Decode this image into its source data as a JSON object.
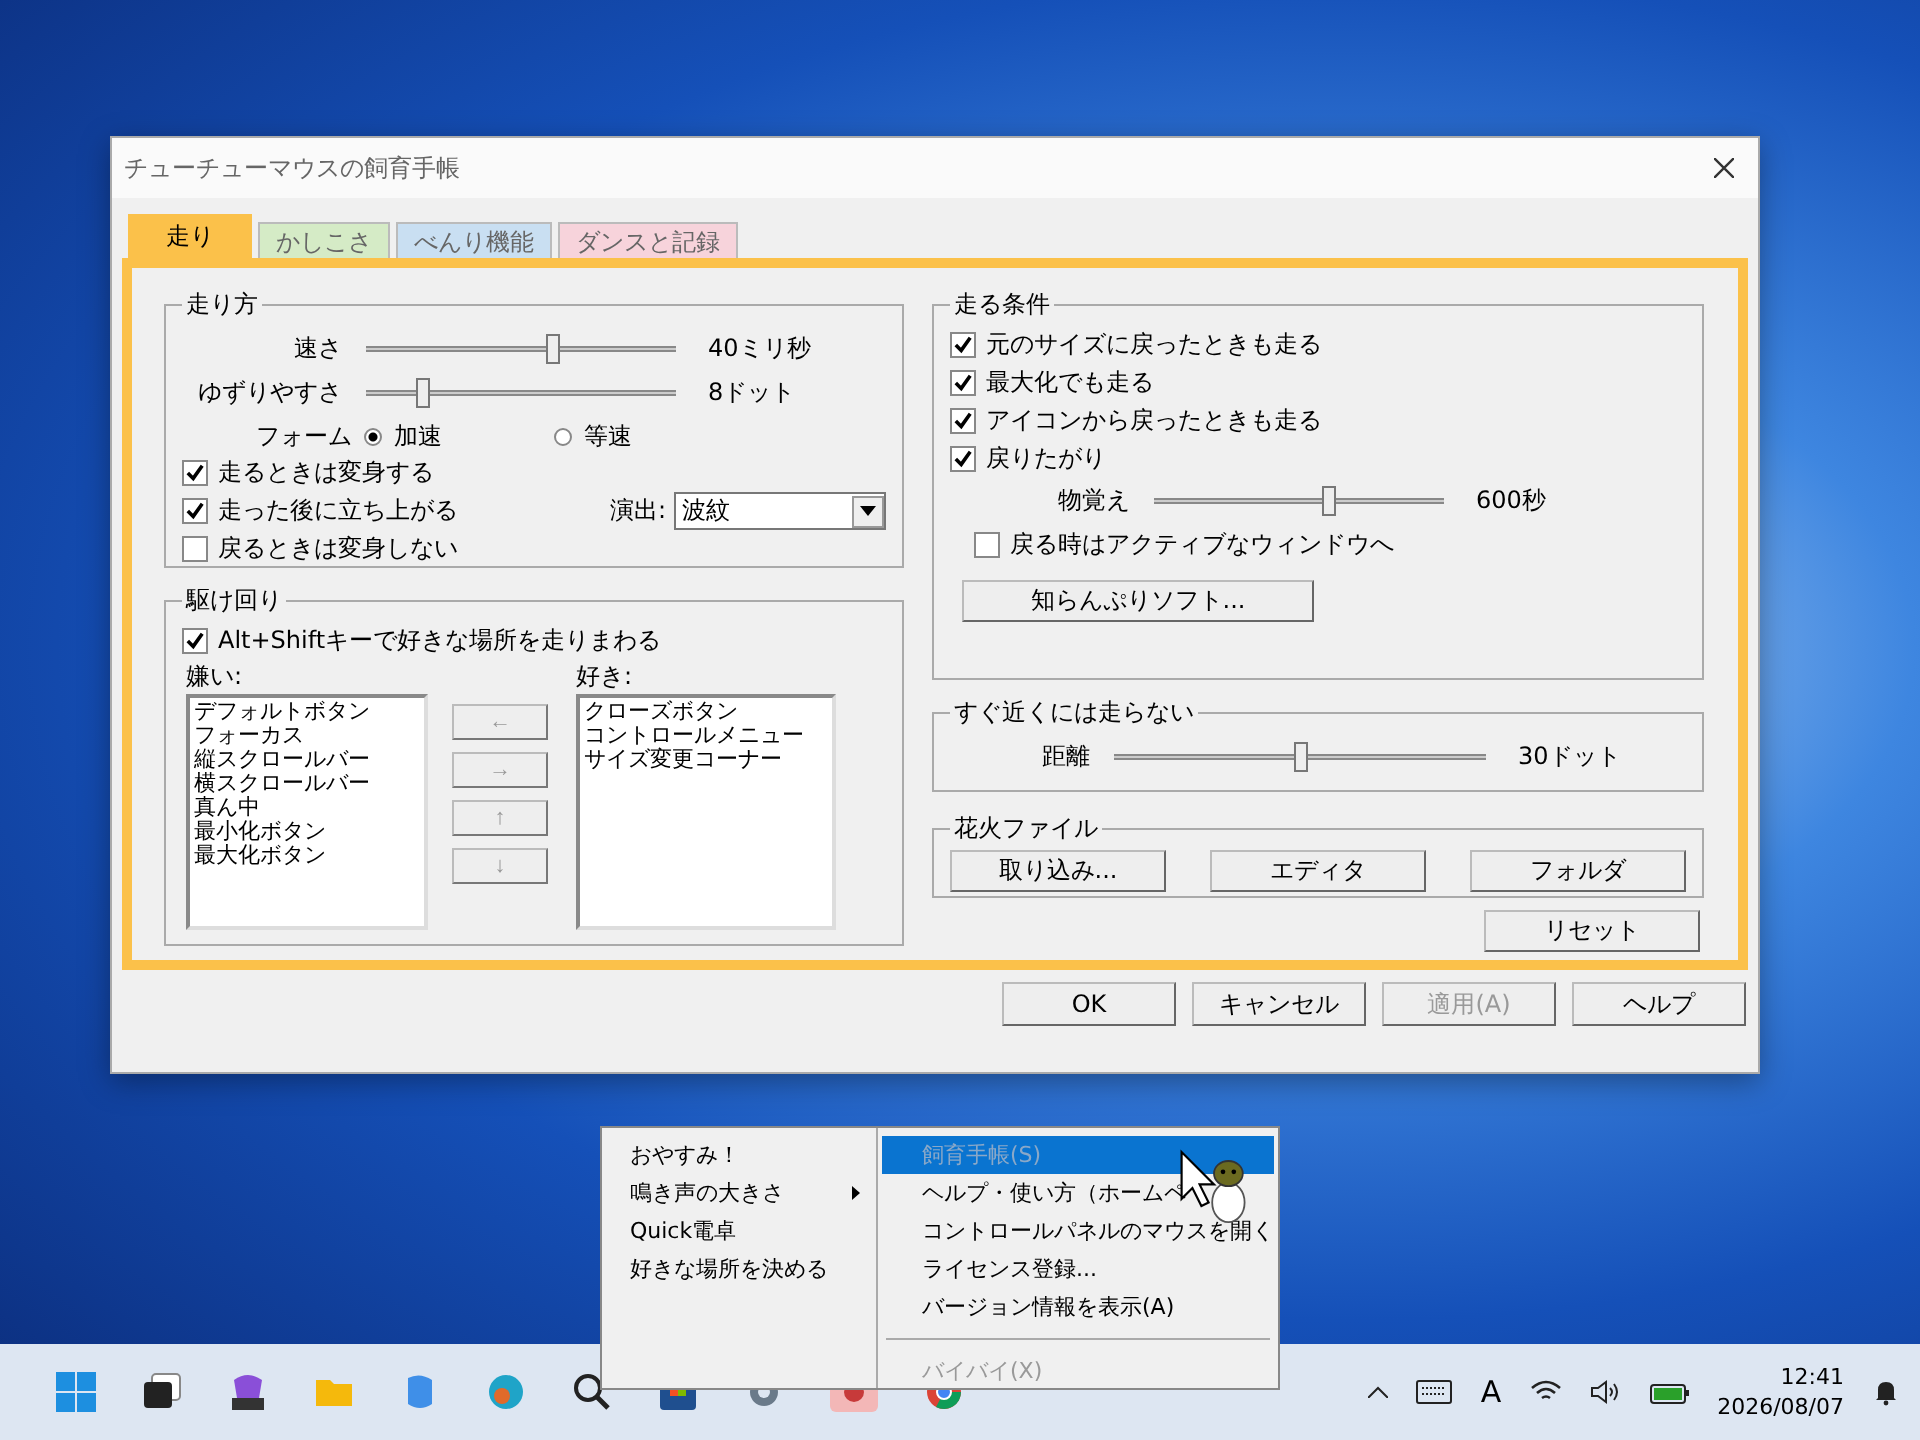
{
  "window": {
    "title": "チューチューマウスの飼育手帳"
  },
  "tabs": [
    {
      "label": "走り",
      "selected": true,
      "color": "#fbc14a"
    },
    {
      "label": "かしこさ",
      "selected": false,
      "color": "#d5ebc6"
    },
    {
      "label": "べんり機能",
      "selected": false,
      "color": "#c9dff2"
    },
    {
      "label": "ダンスと記録",
      "selected": false,
      "color": "#f7d3db"
    }
  ],
  "run_style": {
    "title": "走り方",
    "sliders": [
      {
        "label": "速さ",
        "level": 0.6,
        "reading": "40ミリ秒"
      },
      {
        "label": "ゆずりやすさ",
        "level": 0.18,
        "reading": "8ドット"
      }
    ],
    "form": {
      "label": "フォーム",
      "options": [
        {
          "label": "加速",
          "selected": true
        },
        {
          "label": "等速",
          "selected": false
        }
      ]
    },
    "checks": [
      {
        "label": "走るときは変身する",
        "checked": true
      },
      {
        "label": "走った後に立ち上がる",
        "checked": true
      },
      {
        "label": "戻るときは変身しない",
        "checked": false
      }
    ],
    "effect": {
      "label": "演出:",
      "value": "波紋"
    }
  },
  "roam": {
    "title": "駆け回り",
    "check": {
      "label": "Alt+Shiftキーで好きな場所を走りまわる",
      "checked": true
    },
    "dislike": {
      "label": "嫌い:",
      "items": [
        "デフォルトボタン",
        "フォーカス",
        "縦スクロールバー",
        "横スクロールバー",
        "真ん中",
        "最小化ボタン",
        "最大化ボタン"
      ]
    },
    "like": {
      "label": "好き:",
      "items": [
        "クローズボタン",
        "コントロールメニュー",
        "サイズ変更コーナー"
      ]
    },
    "arrows": [
      "←",
      "→",
      "↑",
      "↓"
    ]
  },
  "conditions": {
    "title": "走る条件",
    "checks": [
      {
        "label": "元のサイズに戻ったときも走る",
        "checked": true
      },
      {
        "label": "最大化でも走る",
        "checked": true
      },
      {
        "label": "アイコンから戻ったときも走る",
        "checked": true
      },
      {
        "label": "戻りたがり",
        "checked": true
      }
    ],
    "slider": {
      "label": "物覚え",
      "level": 0.6,
      "reading": "600秒"
    },
    "check": {
      "label": "戻る時はアクティブなウィンドウへ",
      "checked": false
    },
    "button": "知らんぷりソフト..."
  },
  "near": {
    "title": "すぐ近くには走らない",
    "slider": {
      "label": "距離",
      "level": 0.5,
      "reading": "30ドット"
    }
  },
  "fireworks": {
    "title": "花火ファイル",
    "buttons": [
      "取り込み...",
      "エディタ",
      "フォルダ"
    ]
  },
  "reset": "リセット",
  "buttons": [
    {
      "label": "OK",
      "disabled": false
    },
    {
      "label": "キャンセル",
      "disabled": false
    },
    {
      "label": "適用(A)",
      "disabled": true
    },
    {
      "label": "ヘルプ",
      "disabled": false
    }
  ],
  "context_menu": {
    "left": [
      {
        "label": "おやすみ！",
        "submenu": false
      },
      {
        "label": "鳴き声の大きさ",
        "submenu": true
      },
      {
        "label": "Quick電卓",
        "submenu": false
      },
      {
        "label": "好きな場所を決める",
        "submenu": false
      }
    ],
    "right": [
      {
        "label": "飼育手帳(S)",
        "selected": true,
        "disabled": true,
        "kind": "item"
      },
      {
        "label": "ヘルプ・使い方（ホームペ",
        "selected": false,
        "disabled": false,
        "kind": "item"
      },
      {
        "label": "コントロールパネルのマウスを開く",
        "selected": false,
        "disabled": false,
        "kind": "item"
      },
      {
        "label": "ライセンス登録...",
        "selected": false,
        "disabled": false,
        "kind": "item"
      },
      {
        "label": "バージョン情報を表示(A)",
        "selected": false,
        "disabled": false,
        "kind": "item"
      },
      {
        "kind": "separator"
      },
      {
        "label": "バイバイ(X)",
        "selected": false,
        "disabled": true,
        "kind": "item"
      }
    ]
  },
  "taskbar": {
    "ime": "A",
    "time": "12:41",
    "date": "2026/08/07"
  }
}
